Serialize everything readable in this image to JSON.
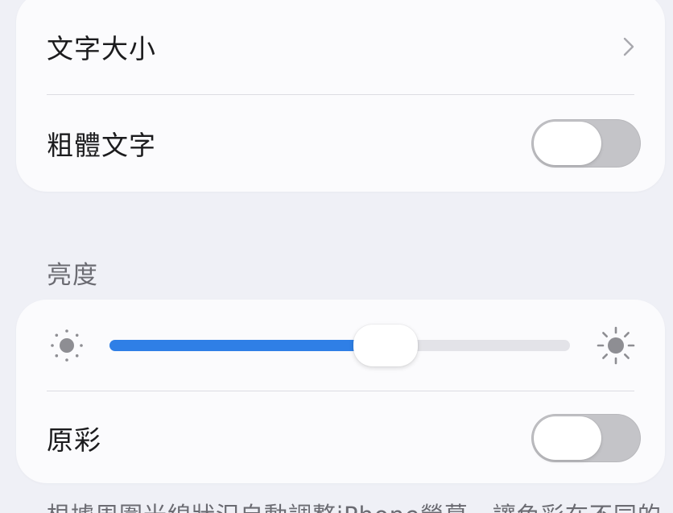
{
  "display_card": {
    "text_size": {
      "label": "文字大小",
      "chevron_icon": "chevron-right-icon"
    },
    "bold_text": {
      "label": "粗體文字",
      "toggle_on": false
    }
  },
  "brightness": {
    "header": "亮度",
    "slider": {
      "value": 0.6,
      "min_icon": "sun-min-icon",
      "max_icon": "sun-max-icon"
    },
    "true_tone": {
      "label": "原彩",
      "toggle_on": false
    }
  },
  "footer": {
    "description": "根據周圍光線狀況自動調整iPhone螢幕，讓色彩在不同的"
  },
  "colors": {
    "background": "#eff0f6",
    "card": "#fbfbfd",
    "accent_blue": "#2f7fe6",
    "toggle_off": "#c4c4c8"
  }
}
